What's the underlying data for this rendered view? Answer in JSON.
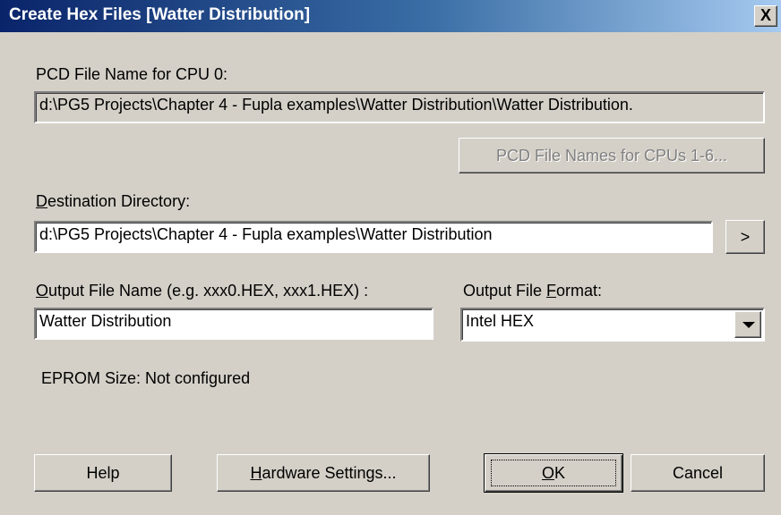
{
  "window": {
    "title": "Create Hex Files [Watter Distribution]",
    "close_label": "X"
  },
  "cpu0": {
    "label": "PCD File Name for CPU 0:",
    "value": "d:\\PG5 Projects\\Chapter 4 - Fupla examples\\Watter Distribution\\Watter Distribution."
  },
  "cpu_names_button": "PCD File Names for CPUs 1-6...",
  "destination": {
    "label_mnemonic": "D",
    "label_rest": "estination Directory:",
    "value": "d:\\PG5 Projects\\Chapter 4 - Fupla examples\\Watter Distribution",
    "browse_label": ">"
  },
  "output_name": {
    "label_mnemonic": "O",
    "label_rest": "utput File Name (e.g. xxx0.HEX, xxx1.HEX) :",
    "value": "Watter Distribution"
  },
  "output_format": {
    "label_prefix": "Output File ",
    "label_mnemonic": "F",
    "label_rest": "ormat:",
    "selected": "Intel HEX"
  },
  "eprom": {
    "text": "EPROM Size:  Not configured"
  },
  "buttons": {
    "help": "Help",
    "hardware_mnemonic": "H",
    "hardware_rest": "ardware Settings...",
    "ok_mnemonic": "O",
    "ok_rest": "K",
    "cancel": "Cancel"
  }
}
